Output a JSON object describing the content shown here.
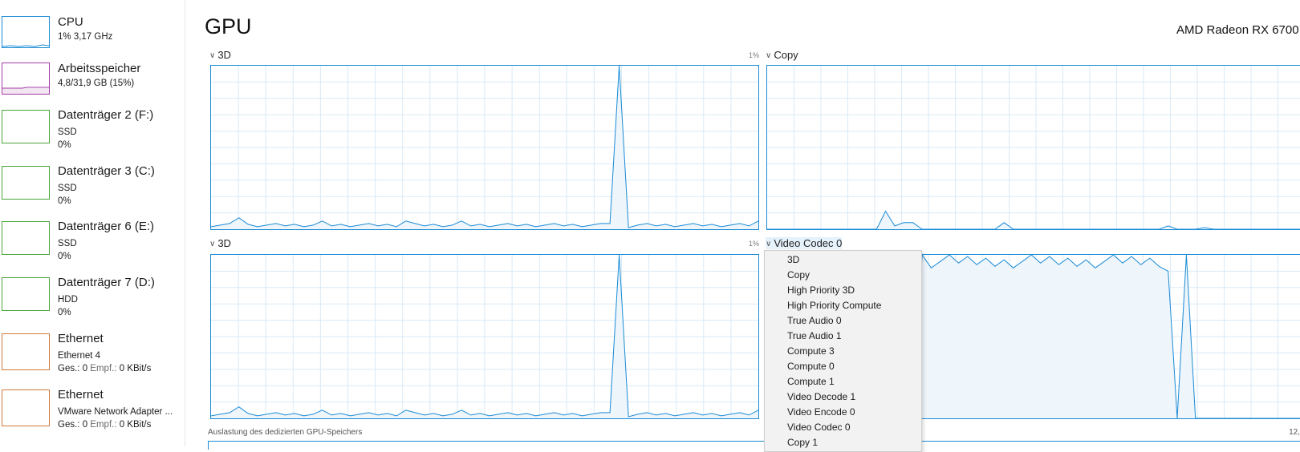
{
  "sidebar": {
    "items": [
      {
        "title": "CPU",
        "line1": "1% 3,17 GHz",
        "line2": "",
        "color": "#1a8bd6"
      },
      {
        "title": "Arbeitsspeicher",
        "line1": "4,8/31,9 GB (15%)",
        "line2": "",
        "color": "#a23aa3"
      },
      {
        "title": "Datenträger 2 (F:)",
        "line1": "SSD",
        "line2": "0%",
        "color": "#4aa33a"
      },
      {
        "title": "Datenträger 3 (C:)",
        "line1": "SSD",
        "line2": "0%",
        "color": "#4aa33a"
      },
      {
        "title": "Datenträger 6 (E:)",
        "line1": "SSD",
        "line2": "0%",
        "color": "#4aa33a"
      },
      {
        "title": "Datenträger 7 (D:)",
        "line1": "HDD",
        "line2": "0%",
        "color": "#4aa33a"
      },
      {
        "title": "Ethernet",
        "line1": "Ethernet 4",
        "send_label": "Ges.:",
        "send_value": "0",
        "recv_label": "Empf.:",
        "recv_value": "0 KBit/s",
        "color": "#d0793a"
      },
      {
        "title": "Ethernet",
        "line1": "VMware Network Adapter ...",
        "send_label": "Ges.:",
        "send_value": "0",
        "recv_label": "Empf.:",
        "recv_value": "0 KBit/s",
        "color": "#d0793a"
      }
    ]
  },
  "main": {
    "title": "GPU",
    "gpu_name": "AMD Radeon RX 6700",
    "engines": [
      {
        "label": "3D",
        "percent": "1%"
      },
      {
        "label": "Copy",
        "percent": ""
      },
      {
        "label": "3D",
        "percent": "1%"
      },
      {
        "label": "Video Codec 0",
        "percent": ""
      }
    ],
    "dedicated_label": "Auslastung des dedizierten GPU-Speichers",
    "dedicated_right": "12,"
  },
  "engine_menu": {
    "items": [
      "3D",
      "Copy",
      "High Priority 3D",
      "High Priority Compute",
      "True Audio 0",
      "True Audio 1",
      "Compute 3",
      "Compute 0",
      "Compute 1",
      "Video Decode 1",
      "Video Encode 0",
      "Video Codec 0",
      "Copy 1"
    ]
  },
  "colors": {
    "graph_line": "#1a8bd6",
    "graph_fill": "#eef5fb",
    "grid": "#d9eaf6"
  }
}
